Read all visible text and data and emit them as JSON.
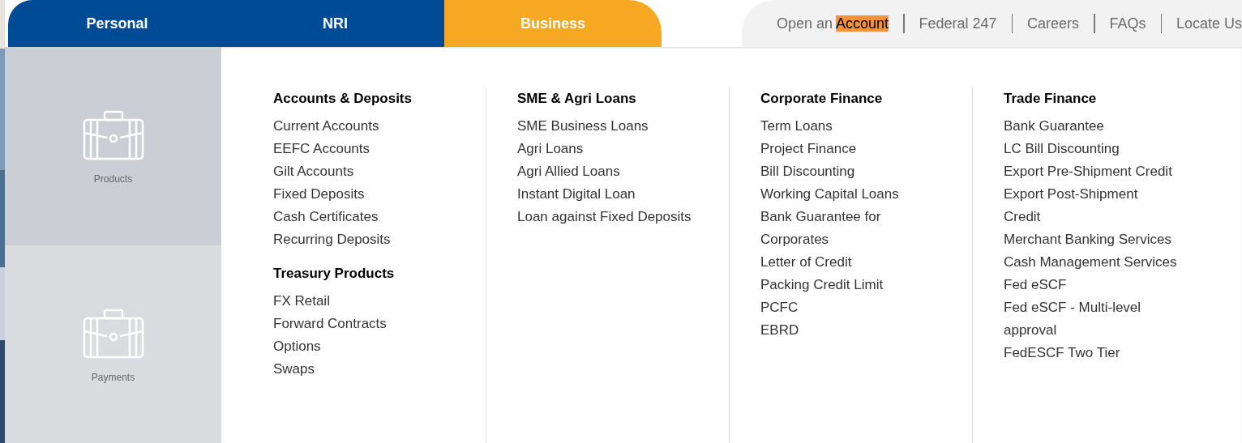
{
  "tabs": [
    {
      "label": "Personal",
      "selected": false
    },
    {
      "label": "NRI",
      "selected": false
    },
    {
      "label": "Business",
      "selected": true
    }
  ],
  "top_links": [
    {
      "label": "Open an",
      "highlighted": "Account"
    },
    {
      "label": "Federal 247"
    },
    {
      "label": "Careers"
    },
    {
      "label": "FAQs"
    },
    {
      "label": "Locate Us"
    }
  ],
  "sidebar": {
    "items": [
      {
        "label": "Products",
        "selected": true
      },
      {
        "label": "Payments",
        "selected": false
      }
    ]
  },
  "menu_columns": [
    {
      "groups": [
        {
          "heading": "Accounts & Deposits",
          "items": [
            "Current Accounts",
            "EEFC Accounts",
            "Gilt Accounts",
            "Fixed Deposits",
            "Cash Certificates",
            "Recurring Deposits"
          ]
        },
        {
          "heading": "Treasury Products",
          "items": [
            "FX Retail",
            "Forward Contracts",
            "Options",
            "Swaps"
          ]
        }
      ]
    },
    {
      "groups": [
        {
          "heading": "SME & Agri Loans",
          "items": [
            "SME Business Loans",
            "Agri Loans",
            "Agri Allied Loans",
            "Instant Digital Loan",
            "Loan against Fixed Deposits"
          ]
        }
      ]
    },
    {
      "groups": [
        {
          "heading": "Corporate Finance",
          "items": [
            "Term Loans",
            "Project Finance",
            "Bill Discounting",
            "Working Capital Loans",
            "Bank Guarantee for Corporates",
            "Letter of Credit",
            "Packing Credit Limit",
            "PCFC",
            "EBRD"
          ]
        }
      ]
    },
    {
      "groups": [
        {
          "heading": "Trade Finance",
          "items": [
            "Bank Guarantee",
            "LC Bill Discounting",
            "Export Pre-Shipment Credit",
            "Export Post-Shipment Credit",
            "Merchant Banking Services",
            "Cash Management Services",
            "Fed eSCF",
            "Fed eSCF - Multi-level approval",
            "FedESCF Two Tier"
          ]
        }
      ]
    }
  ]
}
